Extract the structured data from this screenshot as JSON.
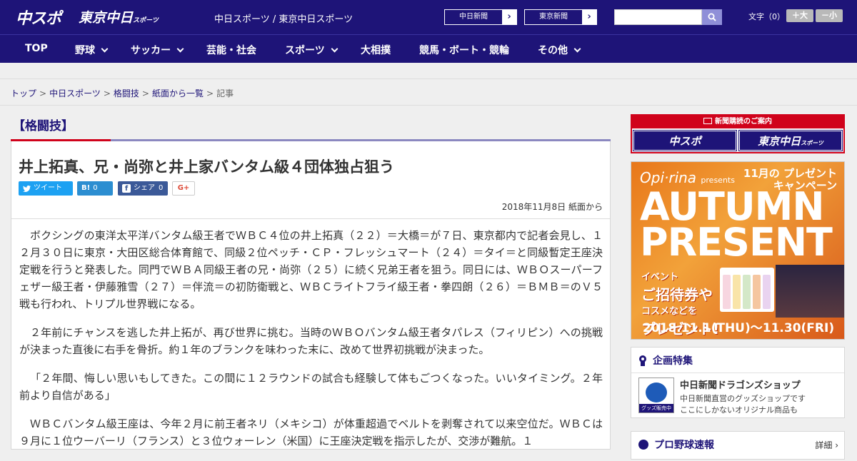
{
  "header": {
    "logo_chusupo": "中スポ",
    "logo_tokyo": "東京中日",
    "logo_tokyo_suffix": "スポーツ",
    "site_title": "中日スポーツ / 東京中日スポーツ",
    "btn_chunichi": "中日新聞",
    "btn_tokyo": "東京新聞",
    "arrow": "›",
    "search_placeholder": "",
    "font_label": "文字（0）",
    "font_plus": "＋大",
    "font_minus": "－小"
  },
  "nav": {
    "items": [
      "TOP",
      "野球",
      "サッカー",
      "芸能・社会",
      "スポーツ",
      "大相撲",
      "競馬・ボート・競輪",
      "その他"
    ]
  },
  "breadcrumb": {
    "items": [
      "トップ",
      "中日スポーツ",
      "格闘技",
      "紙面から一覧"
    ],
    "current": "記事",
    "sep": ">"
  },
  "article": {
    "category": "【格闘技】",
    "headline": "井上拓真、兄・尚弥と井上家バンタム級４団体独占狙う",
    "share": {
      "tweet": "ツイート",
      "hatena_icon": "B!",
      "hatena_count": "0",
      "fb_icon": "f",
      "fb_label": "シェア",
      "fb_count": "0",
      "gplus": "G+"
    },
    "dateline": "2018年11月8日 紙面から",
    "paragraphs": [
      "ボクシングの東洋太平洋バンタム級王者でＷＢＣ４位の井上拓真（２２）＝大橋＝が７日、東京都内で記者会見し、１２月３０日に東京・大田区総合体育館で、同級２位ペッチ・ＣＰ・フレッシュマート（２４）＝タイ＝と同級暫定王座決定戦を行うと発表した。同門でＷＢＡ同級王者の兄・尚弥（２５）に続く兄弟王者を狙う。同日には、ＷＢＯスーパーフェザー級王者・伊藤雅雪（２７）＝伴流＝の初防衛戦と、ＷＢＣライトフライ級王者・拳四朗（２６）＝ＢＭＢ＝のＶ５戦も行われ、トリプル世界戦になる。",
      "２年前にチャンスを逃した井上拓が、再び世界に挑む。当時のＷＢＯバンタム級王者タパレス（フィリピン）への挑戦が決まった直後に右手を骨折。約１年のブランクを味わった末に、改めて世界初挑戦が決まった。",
      "「２年間、悔しい思いもしてきた。この間に１２ラウンドの試合も経験して体もごつくなった。いいタイミング。２年前より自信がある」",
      "ＷＢＣバンタム級王座は、今年２月に前王者ネリ（メキシコ）が体重超過でベルトを剥奪されて以来空位だ。ＷＢＣは９月に１位ウーバーリ（フランス）と３位ウォーレン（米国）に王座決定戦を指示したが、交渉が難航。１"
    ]
  },
  "sidebar": {
    "subscribe_head": "新聞購読のご案内",
    "sub_chusupo": "中スポ",
    "sub_tokyo": "東京中日",
    "sub_tokyo_suffix": "スポーツ",
    "ad": {
      "brand": "Opi·rina",
      "presents": "presents",
      "campaign_line1": "11月の プレゼント",
      "campaign_line2": "キャンペーン",
      "title1": "AUTUMN",
      "title2": "PRESENT",
      "sub1": "イベント",
      "sub2": "ご招待券や",
      "sub3": "コスメなどを",
      "sub4": "プレゼント!",
      "dates": "2018.11.1(THU)～11.30(FRI)"
    },
    "feature": {
      "title": "企画特集",
      "shop_title": "中日新聞ドラゴンズショップ",
      "shop_desc1": "中日新聞直営のグッズショップです",
      "shop_desc2": "ここにしかないオリジナル商品も",
      "shop_badge": "グッズ販売中"
    },
    "baseball": {
      "title": "プロ野球速報",
      "more": "詳細 ›"
    }
  },
  "colors": {
    "brand_navy": "#1e1478",
    "accent_red": "#d0021b"
  }
}
